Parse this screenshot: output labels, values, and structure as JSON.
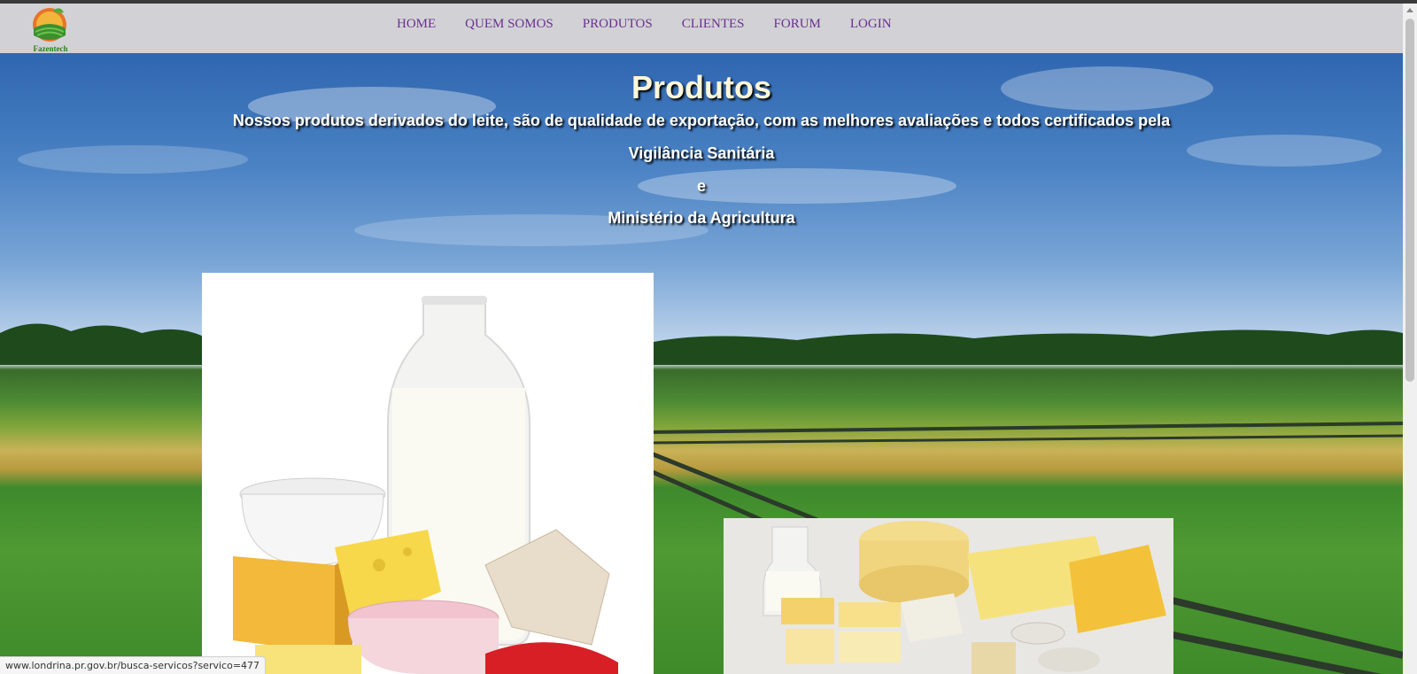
{
  "brand": {
    "logo_text": "Fazentech"
  },
  "nav": {
    "items": [
      "HOME",
      "QUEM SOMOS",
      "PRODUTOS",
      "CLIENTES",
      "FORUM",
      "LOGIN"
    ]
  },
  "hero": {
    "title": "Produtos",
    "description": [
      "Nossos produtos derivados do leite, são de qualidade de exportação, com as melhores avaliações e todos certificados pela",
      "Vigilância Sanitária",
      "e",
      "Ministério da Agricultura"
    ]
  },
  "status_bar": {
    "url": "www.londrina.pr.gov.br/busca-servicos?servico=477"
  },
  "colors": {
    "nav_link": "#6b2f8f",
    "header_bg": "#d2d2d6",
    "title": "#fdf6d8"
  }
}
